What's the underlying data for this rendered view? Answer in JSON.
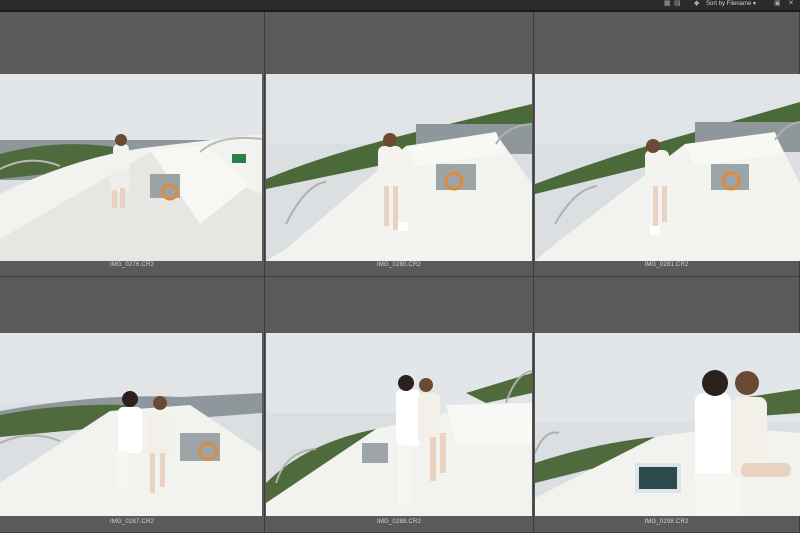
{
  "toolbar": {
    "sort_label": "Sort by Filename ▾",
    "grid_view_icon": "grid-view-icon",
    "list_view_icon": "list-view-icon",
    "filter_icon": "filter-icon",
    "folder_icon": "folder-icon",
    "close_icon": "close-icon"
  },
  "thumbnails": [
    {
      "filename": "IMG_0276.CR2",
      "scene": "woman-bow-left"
    },
    {
      "filename": "IMG_0280.CR2",
      "scene": "woman-bow-right"
    },
    {
      "filename": "IMG_0281.CR2",
      "scene": "woman-bow-right-2"
    },
    {
      "filename": "IMG_0287.CR2",
      "scene": "couple-bow"
    },
    {
      "filename": "IMG_0288.CR2",
      "scene": "couple-kiss"
    },
    {
      "filename": "IMG_0298.CR2",
      "scene": "couple-close"
    }
  ],
  "colors": {
    "background": "#4e4e4e",
    "cell": "#5a5a5a",
    "toolbar": "#2b2b2b",
    "caption": "#d6d6d6"
  }
}
